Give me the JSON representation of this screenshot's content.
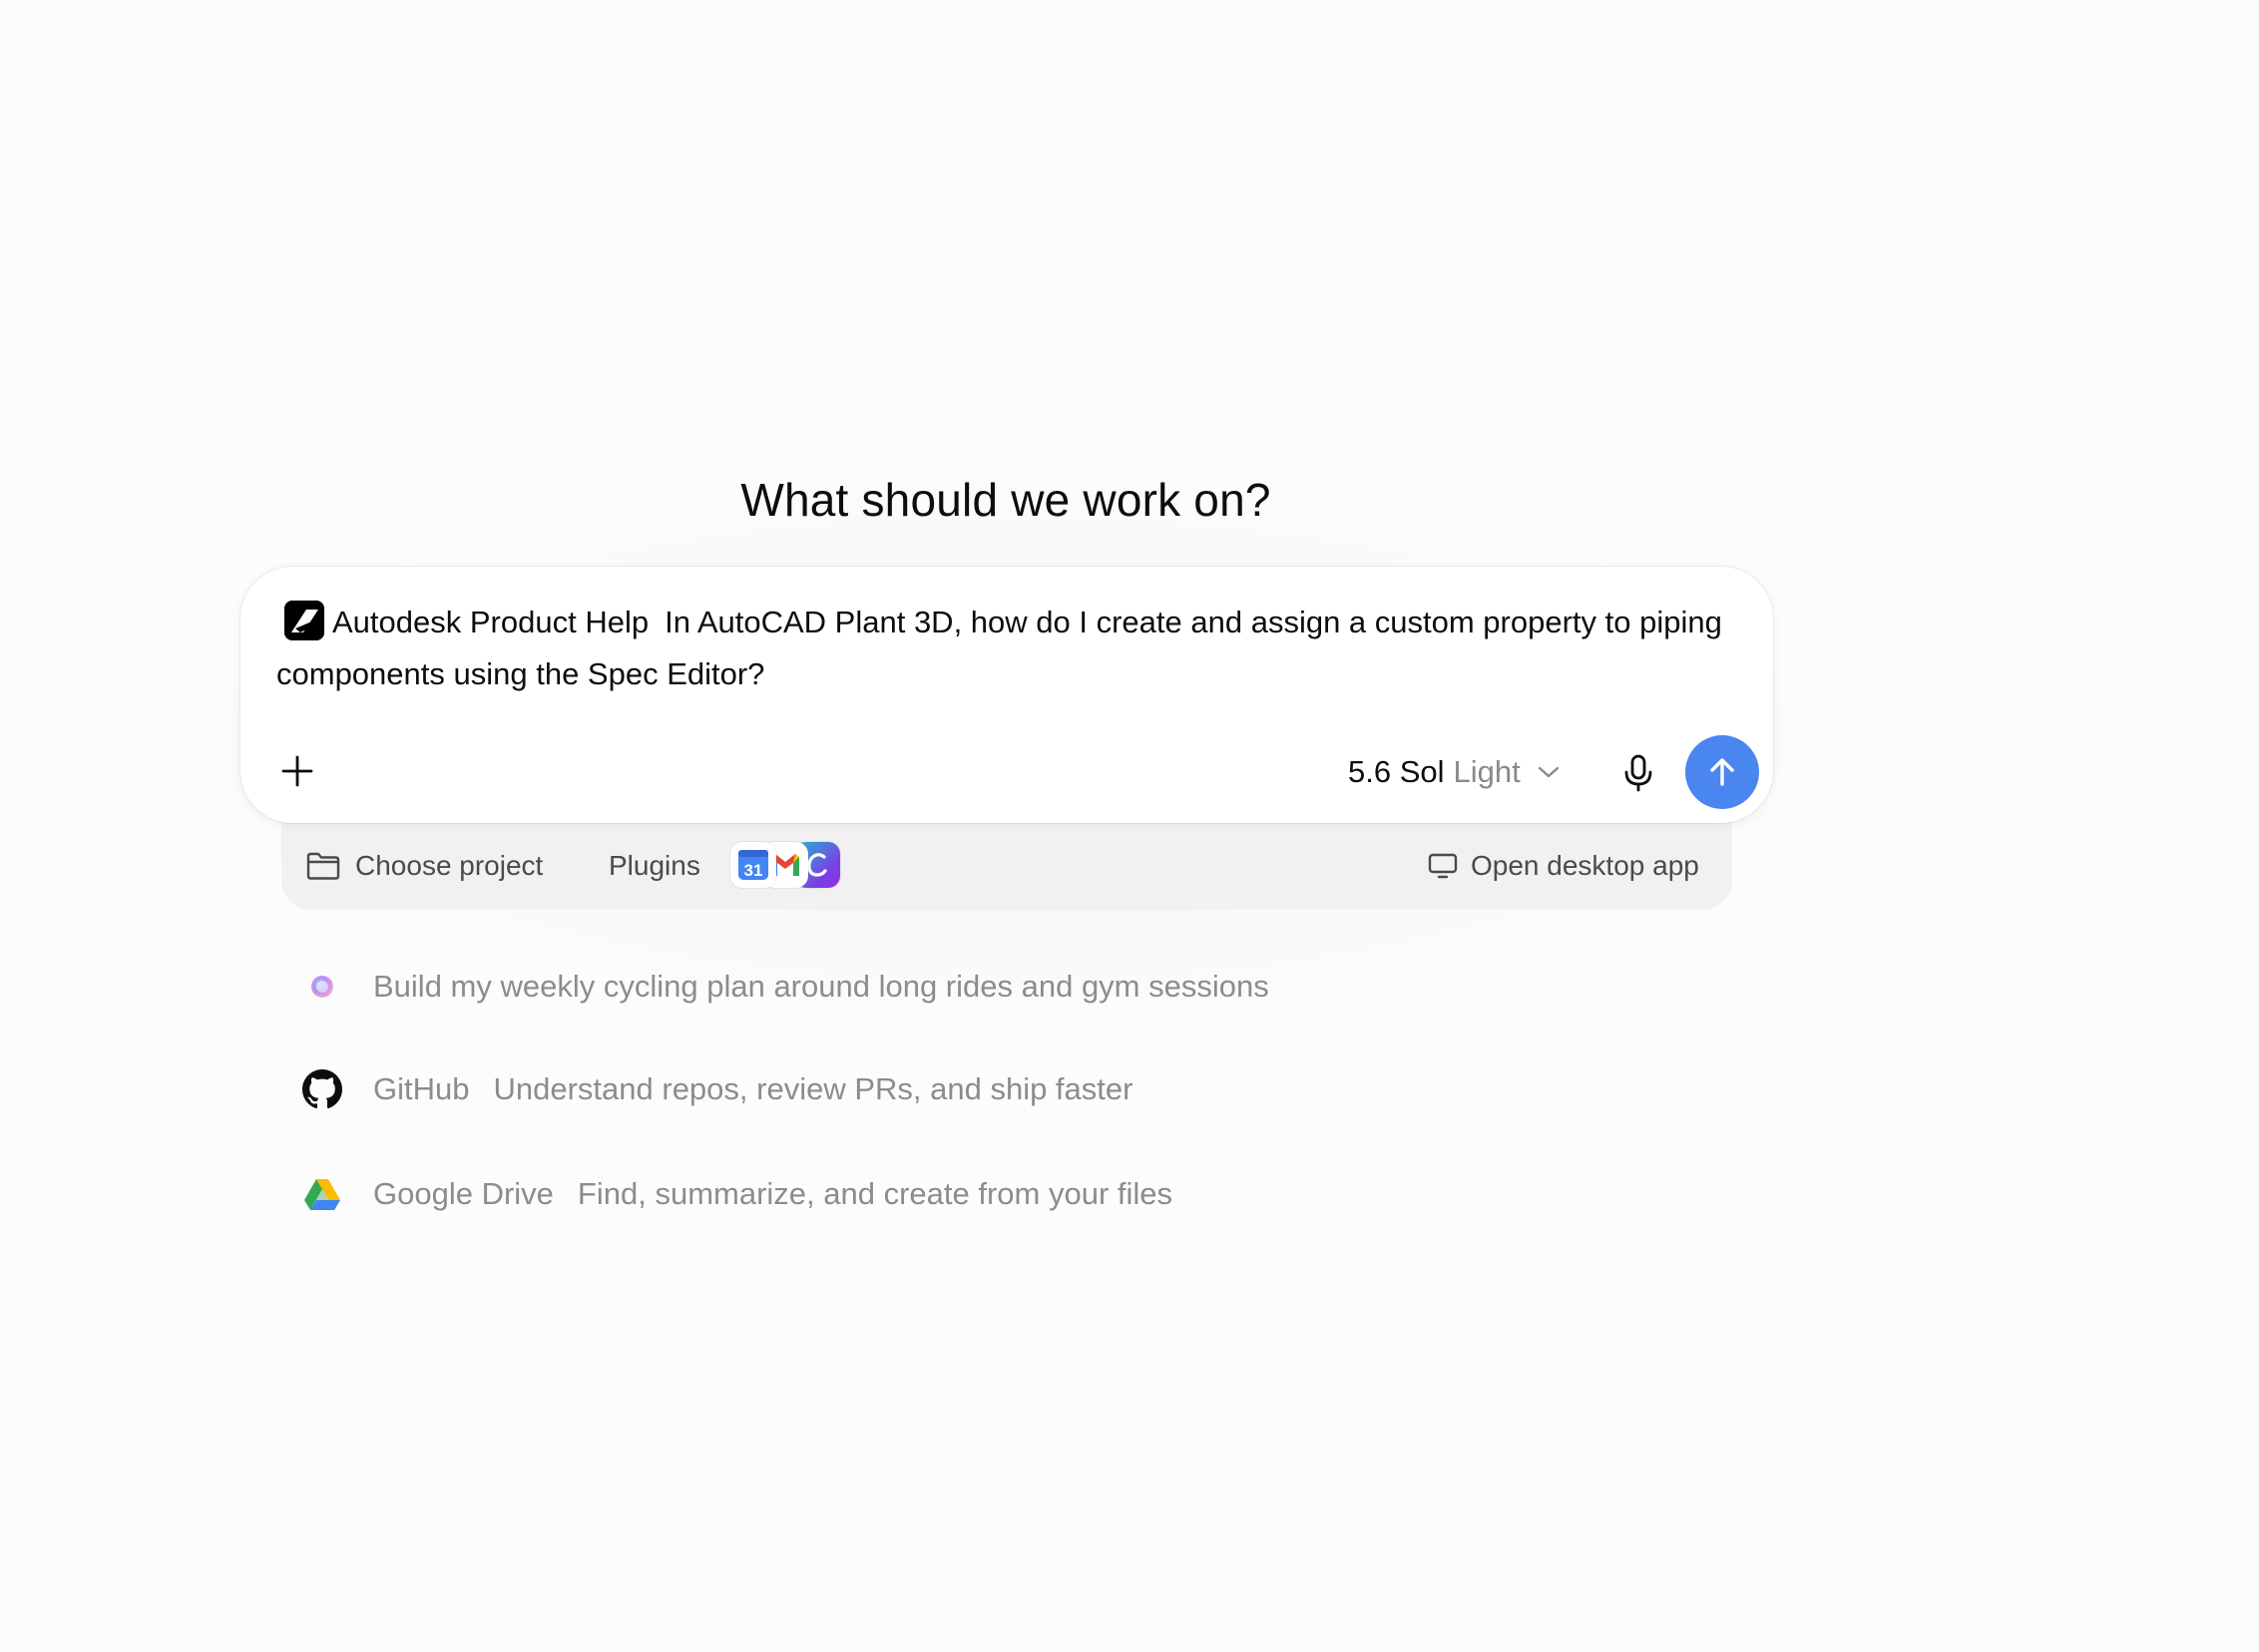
{
  "heading": "What should we work on?",
  "composer": {
    "app_chip": "Autodesk Product Help",
    "prompt_text": "In AutoCAD Plant 3D, how do I create and assign a custom property to piping components using the Spec Editor?",
    "model_name": "5.6 Sol",
    "model_variant": "Light",
    "icons": {
      "add": "plus-icon",
      "model_dropdown": "chevron-down-icon",
      "mic": "microphone-icon",
      "send": "arrow-up-icon"
    },
    "colors": {
      "send_button": "#4a86f0"
    }
  },
  "tray": {
    "choose_project": "Choose project",
    "plugins": "Plugins",
    "plugin_icons": [
      "calendar-icon",
      "gmail-icon",
      "canva-icon"
    ],
    "calendar_day": "31",
    "open_desktop_app": "Open desktop app"
  },
  "suggestions": [
    {
      "icon": "sparkle-orb-icon",
      "app": "",
      "text": "Build my weekly cycling plan around long rides and gym sessions"
    },
    {
      "icon": "github-icon",
      "app": "GitHub",
      "text": "Understand repos, review PRs, and ship faster"
    },
    {
      "icon": "google-drive-icon",
      "app": "Google Drive",
      "text": "Find, summarize, and create from your files"
    }
  ]
}
